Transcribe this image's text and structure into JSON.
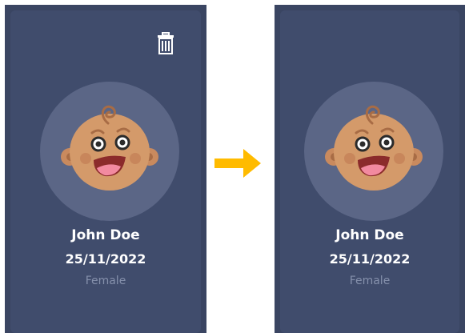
{
  "colors": {
    "panel_bg": "#3a4562",
    "card_bg": "#404c6c",
    "avatar_bg": "#5b6686",
    "arrow": "#ffbb00",
    "gender_text": "#8590ab"
  },
  "before": {
    "name": "John Doe",
    "dob": "25/11/2022",
    "gender": "Female",
    "delete_icon": "trash-icon"
  },
  "after": {
    "name": "John Doe",
    "dob": "25/11/2022",
    "gender": "Female"
  },
  "transition_icon": "arrow-right-icon",
  "avatar_icon": "baby-face-icon"
}
